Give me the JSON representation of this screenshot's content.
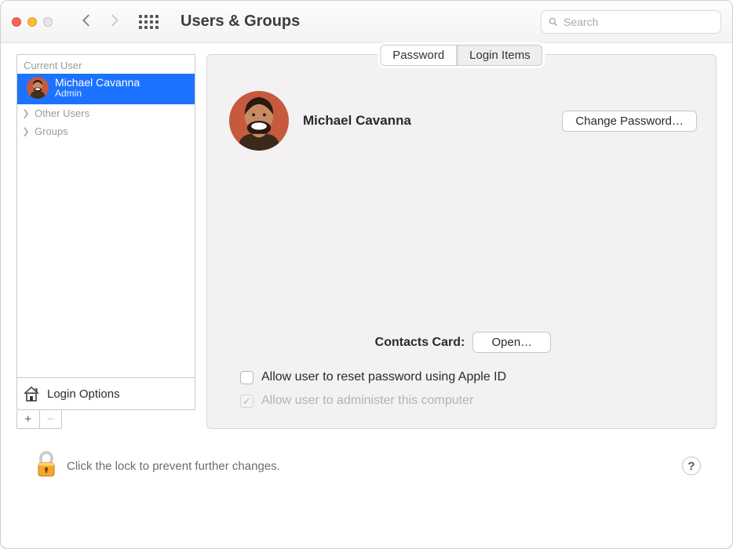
{
  "header": {
    "title": "Users & Groups",
    "search_placeholder": "Search"
  },
  "sidebar": {
    "section_label": "Current User",
    "current_user": {
      "name": "Michael Cavanna",
      "role": "Admin"
    },
    "rows": [
      {
        "label": "Other Users"
      },
      {
        "label": "Groups"
      }
    ],
    "login_options_label": "Login Options",
    "add_label": "+",
    "remove_label": "−"
  },
  "main": {
    "tabs": {
      "password": "Password",
      "login_items": "Login Items"
    },
    "profile_name": "Michael Cavanna",
    "change_password_label": "Change Password…",
    "contacts_label": "Contacts Card:",
    "open_label": "Open…",
    "allow_reset_label": "Allow user to reset password using Apple ID",
    "allow_admin_label": "Allow user to administer this computer"
  },
  "lock": {
    "text": "Click the lock to prevent further changes.",
    "help": "?"
  }
}
